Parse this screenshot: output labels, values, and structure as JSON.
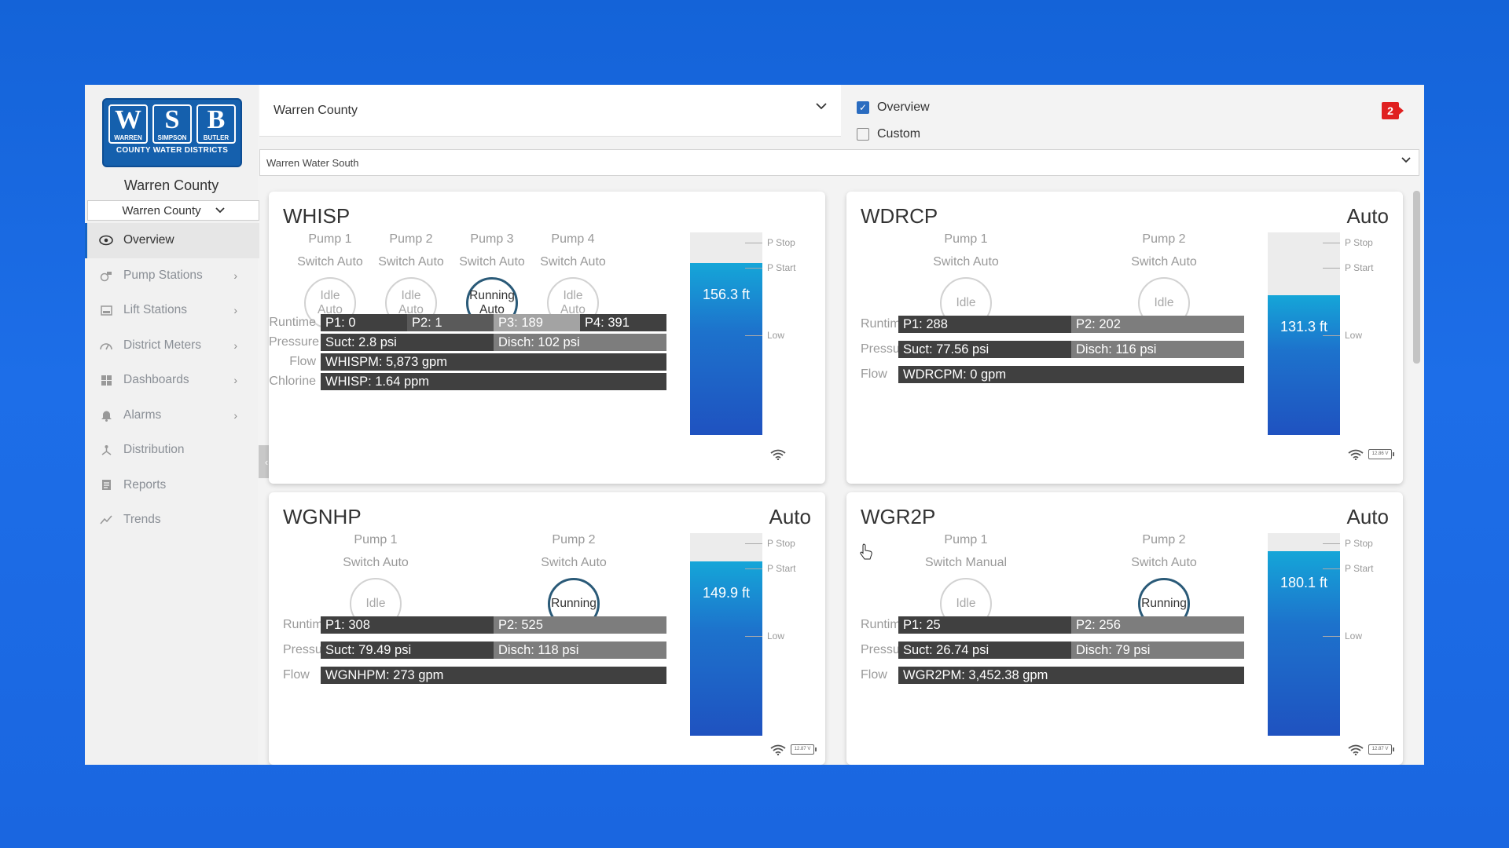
{
  "logo": {
    "letters": [
      {
        "big": "W",
        "small": "WARREN"
      },
      {
        "big": "S",
        "small": "SIMPSON"
      },
      {
        "big": "B",
        "small": "BUTLER"
      }
    ],
    "tagline": "COUNTY WATER DISTRICTS"
  },
  "sidebar": {
    "county_title": "Warren County",
    "county_select": "Warren County",
    "items": [
      {
        "label": "Overview",
        "icon": "eye-icon",
        "active": true
      },
      {
        "label": "Pump Stations",
        "icon": "pump-icon"
      },
      {
        "label": "Lift Stations",
        "icon": "lift-station-icon"
      },
      {
        "label": "District Meters",
        "icon": "gauge-icon"
      },
      {
        "label": "Dashboards",
        "icon": "dashboard-icon"
      },
      {
        "label": "Alarms",
        "icon": "bell-icon"
      },
      {
        "label": "Distribution",
        "icon": "distribution-icon"
      },
      {
        "label": "Reports",
        "icon": "report-icon"
      },
      {
        "label": "Trends",
        "icon": "trend-icon"
      }
    ]
  },
  "header": {
    "county_select": "Warren County",
    "view_options": [
      {
        "label": "Overview",
        "checked": true
      },
      {
        "label": "Custom",
        "checked": false
      }
    ],
    "alarm_count": "2",
    "system_select": "Warren Water South"
  },
  "colors": {
    "accent": "#1564c4",
    "alarm": "#e02020",
    "tank_fill": "#1d72cc",
    "running_ring": "#2a5a78"
  },
  "stations": [
    {
      "name": "WHISP",
      "mode": "",
      "pumps": [
        {
          "name": "Pump 1",
          "switch": "Switch Auto",
          "status": [
            "Idle",
            "Auto"
          ],
          "running": false
        },
        {
          "name": "Pump 2",
          "switch": "Switch Auto",
          "status": [
            "Idle",
            "Auto"
          ],
          "running": false
        },
        {
          "name": "Pump 3",
          "switch": "Switch Auto",
          "status": [
            "Running",
            "Auto"
          ],
          "running": true
        },
        {
          "name": "Pump 4",
          "switch": "Switch Auto",
          "status": [
            "Idle",
            "Auto"
          ],
          "running": false
        }
      ],
      "rows": [
        {
          "label": "Runtime",
          "values": [
            "P1: 0",
            "P2: 1",
            "P3: 189",
            "P4: 391"
          ]
        },
        {
          "label": "Pressure",
          "values": [
            "Suct: 2.8 psi",
            "Disch: 102 psi"
          ]
        },
        {
          "label": "Flow",
          "values": [
            "WHISPM: 5,873 gpm"
          ]
        },
        {
          "label": "Chlorine",
          "values": [
            "WHISP: 1.64 ppm"
          ]
        }
      ],
      "tank": {
        "level": "156.3 ft",
        "fill_fraction": 0.85,
        "marks": [
          "P Stop",
          "P Start",
          "Low"
        ]
      },
      "battery": ""
    },
    {
      "name": "WDRCP",
      "mode": "Auto",
      "pumps": [
        {
          "name": "Pump 1",
          "switch": "Switch Auto",
          "status": [
            "Idle"
          ],
          "running": false
        },
        {
          "name": "Pump 2",
          "switch": "Switch Auto",
          "status": [
            "Idle"
          ],
          "running": false
        }
      ],
      "rows": [
        {
          "label": "Runtime",
          "values": [
            "P1: 288",
            "P2: 202"
          ]
        },
        {
          "label": "Pressure",
          "values": [
            "Suct: 77.56 psi",
            "Disch: 116 psi"
          ]
        },
        {
          "label": "Flow",
          "values": [
            "WDRCPM: 0 gpm"
          ]
        }
      ],
      "tank": {
        "level": "131.3 ft",
        "fill_fraction": 0.69,
        "marks": [
          "P Stop",
          "P Start",
          "Low"
        ]
      },
      "battery": "12.86 V"
    },
    {
      "name": "WGNHP",
      "mode": "Auto",
      "pumps": [
        {
          "name": "Pump 1",
          "switch": "Switch Auto",
          "status": [
            "Idle"
          ],
          "running": false
        },
        {
          "name": "Pump 2",
          "switch": "Switch Auto",
          "status": [
            "Running"
          ],
          "running": true
        }
      ],
      "rows": [
        {
          "label": "Runtime",
          "values": [
            "P1: 308",
            "P2: 525"
          ]
        },
        {
          "label": "Pressure",
          "values": [
            "Suct: 79.49 psi",
            "Disch: 118 psi"
          ]
        },
        {
          "label": "Flow",
          "values": [
            "WGNHPM: 273 gpm"
          ]
        }
      ],
      "tank": {
        "level": "149.9 ft",
        "fill_fraction": 0.86,
        "marks": [
          "P Stop",
          "P Start",
          "Low"
        ]
      },
      "battery": "12.87 V"
    },
    {
      "name": "WGR2P",
      "mode": "Auto",
      "pumps": [
        {
          "name": "Pump 1",
          "switch": "Switch Manual",
          "status": [
            "Idle"
          ],
          "running": false
        },
        {
          "name": "Pump 2",
          "switch": "Switch Auto",
          "status": [
            "Running"
          ],
          "running": true
        }
      ],
      "rows": [
        {
          "label": "Runtime",
          "values": [
            "P1: 25",
            "P2: 256"
          ]
        },
        {
          "label": "Pressure",
          "values": [
            "Suct: 26.74 psi",
            "Disch: 79 psi"
          ]
        },
        {
          "label": "Flow",
          "values": [
            "WGR2PM: 3,452.38 gpm"
          ]
        }
      ],
      "tank": {
        "level": "180.1 ft",
        "fill_fraction": 0.91,
        "marks": [
          "P Stop",
          "P Start",
          "Low"
        ]
      },
      "battery": "12.87 V"
    }
  ]
}
